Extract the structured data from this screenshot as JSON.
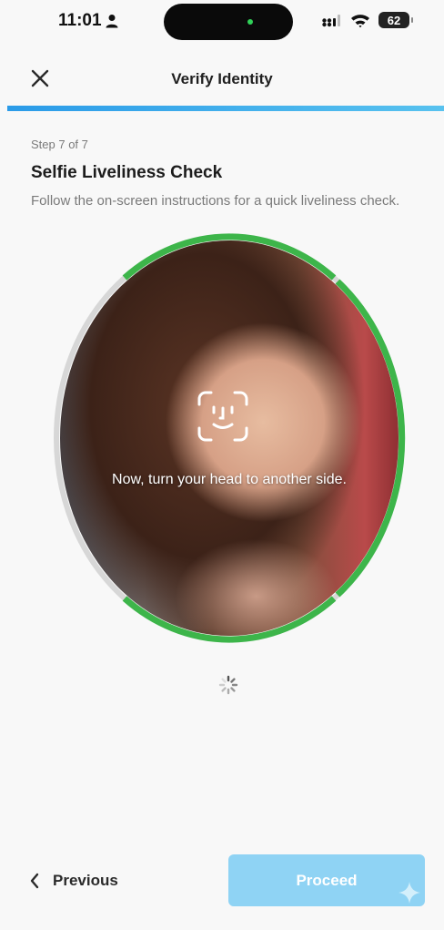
{
  "status_bar": {
    "time": "11:01",
    "battery": "62"
  },
  "header": {
    "title": "Verify Identity",
    "progress": 1.0
  },
  "step": {
    "label": "Step 7 of 7",
    "title": "Selfie Liveliness Check",
    "description": "Follow the on-screen instructions for a quick liveliness check."
  },
  "camera": {
    "instruction": "Now, turn your head to another side.",
    "ring_color": "#3db54a"
  },
  "footer": {
    "previous_label": "Previous",
    "proceed_label": "Proceed"
  },
  "colors": {
    "accent": "#2b9be8",
    "proceed_bg": "#8fd3f4",
    "ring_active": "#3db54a",
    "ring_inactive": "#d7d7d7"
  },
  "icons": [
    "person-icon",
    "signal-icon",
    "wifi-icon",
    "battery-icon",
    "close-icon",
    "face-id-icon",
    "spinner-icon",
    "chevron-left-icon",
    "sparkle-icon"
  ]
}
